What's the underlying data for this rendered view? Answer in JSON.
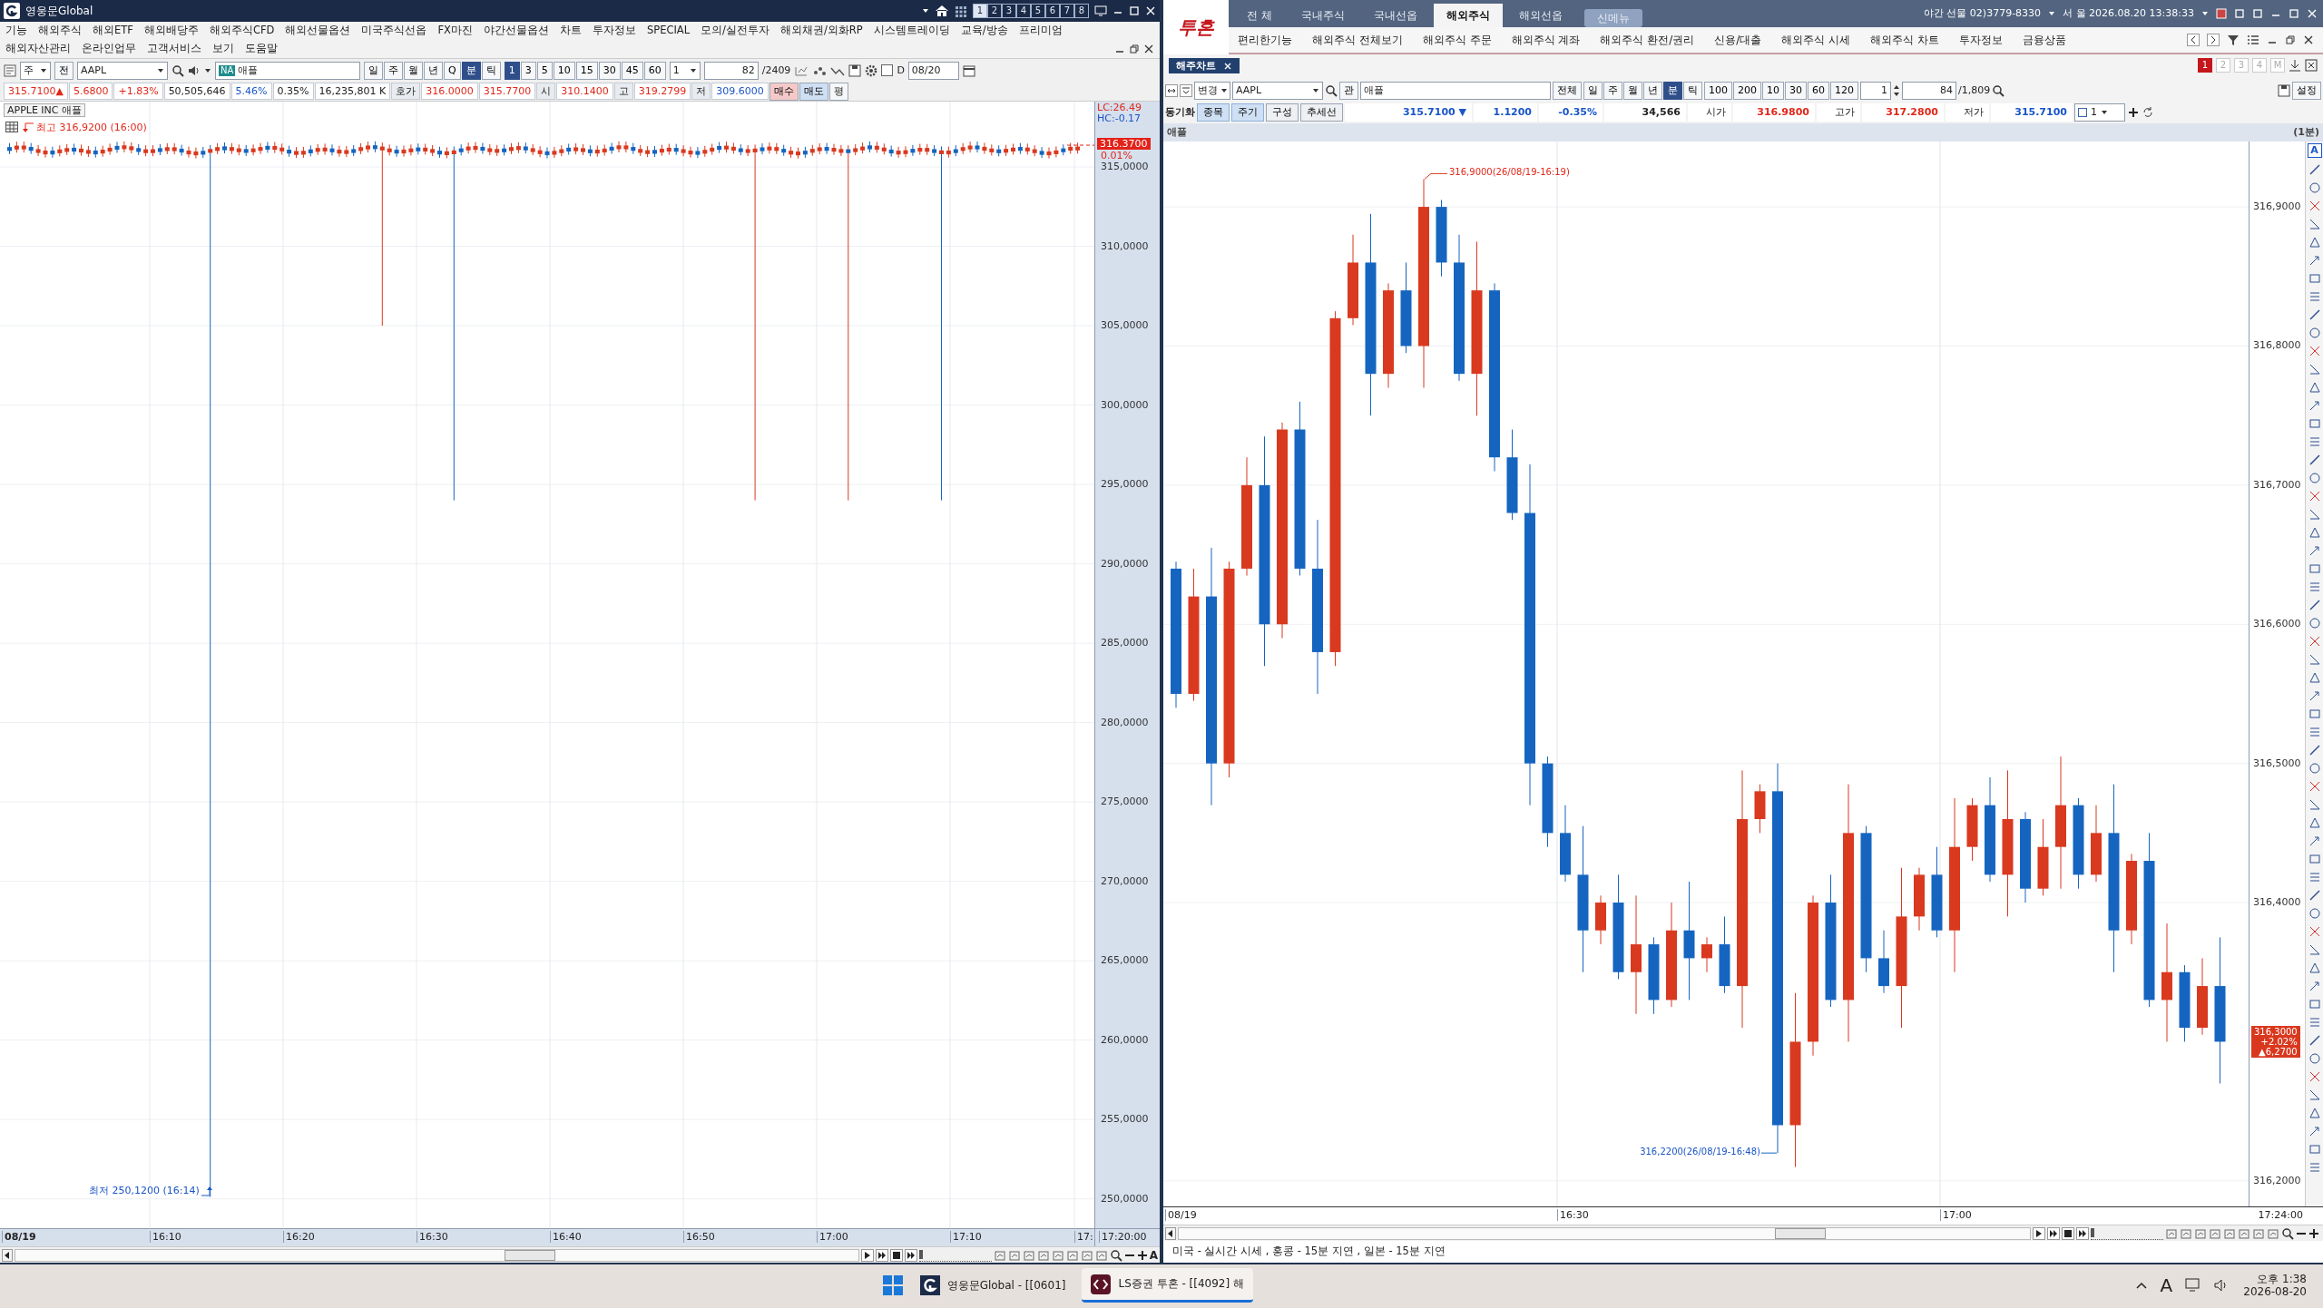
{
  "left_window": {
    "title": "영웅문Global",
    "pages": [
      {
        "label": "1",
        "selected": true
      },
      {
        "label": "2",
        "selected": false
      },
      {
        "label": "3",
        "selected": false
      },
      {
        "label": "4",
        "selected": false
      },
      {
        "label": "5",
        "selected": false
      },
      {
        "label": "6",
        "selected": false
      },
      {
        "label": "7",
        "selected": false
      },
      {
        "label": "8",
        "selected": false
      }
    ],
    "menu_rows": [
      [
        "기능",
        "해외주식",
        "해외ETF",
        "해외배당주",
        "해외주식CFD",
        "해외선물옵션",
        "미국주식선옵",
        "FX마진",
        "야간선물옵션",
        "차트",
        "투자정보",
        "SPECIAL",
        "모의/실전투자",
        "해외채권/외화RP",
        "시스템트레이딩",
        "교육/방송",
        "프리미엄"
      ],
      [
        "해외자산관리",
        "온라인업무",
        "고객서비스",
        "보기",
        "도움말"
      ]
    ],
    "toolbar": {
      "market": "주",
      "scope": "전",
      "symbol": "AAPL",
      "badge": "NA",
      "name": "애플",
      "periods": [
        {
          "label": "일",
          "selected": false
        },
        {
          "label": "주",
          "selected": false
        },
        {
          "label": "월",
          "selected": false
        },
        {
          "label": "년",
          "selected": false
        },
        {
          "label": "Q",
          "selected": false
        },
        {
          "label": "분",
          "selected": true
        },
        {
          "label": "틱",
          "selected": false
        }
      ],
      "intervals": [
        {
          "label": "1",
          "selected": true
        },
        {
          "label": "3",
          "selected": false
        },
        {
          "label": "5",
          "selected": false
        },
        {
          "label": "10",
          "selected": false
        },
        {
          "label": "15",
          "selected": false
        },
        {
          "label": "30",
          "selected": false
        },
        {
          "label": "45",
          "selected": false
        },
        {
          "label": "60",
          "selected": false
        }
      ],
      "multiplier": "1",
      "count": "82",
      "total": "/2409",
      "date_flag": "D",
      "date_checked": false,
      "date": "08/20"
    },
    "quote": [
      {
        "text": "315.7100▲",
        "kind": "up"
      },
      {
        "text": "5.6800",
        "kind": "up"
      },
      {
        "text": "+1.83%",
        "kind": "up"
      },
      {
        "text": "50,505,646",
        "kind": "plain"
      },
      {
        "text": "5.46%",
        "kind": "down"
      },
      {
        "text": "0.35%",
        "kind": "plain"
      },
      {
        "text": "16,235,801 K",
        "kind": "plain"
      },
      {
        "text": "호가",
        "kind": "label"
      },
      {
        "text": "316.0000",
        "kind": "up"
      },
      {
        "text": "315.7700",
        "kind": "up"
      },
      {
        "text": "시",
        "kind": "label"
      },
      {
        "text": "310.1400",
        "kind": "up"
      },
      {
        "text": "고",
        "kind": "label"
      },
      {
        "text": "319.2799",
        "kind": "up"
      },
      {
        "text": "저",
        "kind": "label"
      },
      {
        "text": "309.6000",
        "kind": "down"
      }
    ],
    "order_buttons": [
      {
        "label": "매수",
        "kind": "buy"
      },
      {
        "label": "매도",
        "kind": "sell"
      },
      {
        "label": "평",
        "kind": "plain"
      }
    ],
    "chart": {
      "legend": "APPLE INC  애플",
      "high_note": "최고 316,9200 (16:00)",
      "low_note": "최저 250,1200 (16:14)",
      "lc": "LC:26.49",
      "hc": "HC:-0.17",
      "price_tag": "316.3700",
      "change_tag": "0.01%",
      "y_labels": [
        "315,0000",
        "310,0000",
        "305,0000",
        "300,0000",
        "295,0000",
        "290,0000",
        "285,0000",
        "280,0000",
        "275,0000",
        "270,0000",
        "265,0000",
        "260,0000",
        "255,0000",
        "250,0000"
      ],
      "x_labels": [
        "08/19",
        "16:10",
        "16:20",
        "16:30",
        "16:40",
        "16:50",
        "17:00",
        "17:10",
        "17:"
      ],
      "x_end": "17:20:00"
    },
    "zoom": {
      "level": 0
    },
    "font_button": "A"
  },
  "right_window": {
    "logo": "투혼",
    "tabs": [
      {
        "label": "전 체",
        "kind": "tab",
        "selected": false
      },
      {
        "label": "국내주식",
        "kind": "tab",
        "selected": false
      },
      {
        "label": "국내선옵",
        "kind": "tab",
        "selected": false
      },
      {
        "label": "해외주식",
        "kind": "tab",
        "selected": true
      },
      {
        "label": "해외선옵",
        "kind": "tab",
        "selected": false
      },
      {
        "label": "신메뉴",
        "kind": "menu",
        "selected": false
      }
    ],
    "hotline": "야간 선물 02)3779-8330",
    "clock": "서 울 2026.08.20 13:38:33",
    "menu": [
      "편리한기능",
      "해외주식 전체보기",
      "해외주식 주문",
      "해외주식 계좌",
      "해외주식 환전/권리",
      "신용/대출",
      "해외주식 시세",
      "해외주식 차트",
      "투자정보",
      "금융상품"
    ],
    "doc_tab": "해주차트",
    "screens": [
      {
        "label": "1",
        "selected": true
      },
      {
        "label": "2",
        "selected": false
      },
      {
        "label": "3",
        "selected": false
      },
      {
        "label": "4",
        "selected": false
      },
      {
        "label": "M",
        "selected": false
      }
    ],
    "toolbar": {
      "mode": "변경",
      "symbol": "AAPL",
      "watch": "관",
      "name": "애플",
      "all": "전체",
      "periods": [
        {
          "label": "일",
          "selected": false
        },
        {
          "label": "주",
          "selected": false
        },
        {
          "label": "월",
          "selected": false
        },
        {
          "label": "년",
          "selected": false
        },
        {
          "label": "분",
          "selected": true
        },
        {
          "label": "틱",
          "selected": false
        }
      ],
      "intervals": [
        "100",
        "200",
        "10",
        "30",
        "60",
        "120"
      ],
      "multiplier": "1",
      "count": "84",
      "total": "/1,809",
      "settings": "설정"
    },
    "sync": "동기화",
    "view_buttons": [
      {
        "label": "종목",
        "selected": true
      },
      {
        "label": "주기",
        "selected": true
      },
      {
        "label": "구성",
        "selected": false
      },
      {
        "label": "추세선",
        "selected": false
      }
    ],
    "quote": [
      {
        "text": "315.7100 ▼",
        "kind": "down"
      },
      {
        "text": "1.1200",
        "kind": "down"
      },
      {
        "text": "-0.35%",
        "kind": "down"
      },
      {
        "text": "34,566",
        "kind": "plain"
      },
      {
        "text": "시가",
        "kind": "label"
      },
      {
        "text": "316.9800",
        "kind": "up"
      },
      {
        "text": "고가",
        "kind": "label"
      },
      {
        "text": "317.2800",
        "kind": "up"
      },
      {
        "text": "저가",
        "kind": "label"
      },
      {
        "text": "315.7100",
        "kind": "down"
      }
    ],
    "chart_count": "1",
    "chart": {
      "title": "애플",
      "period": "(1분)",
      "high_note": "316,9000(26/08/19-16:19)",
      "low_note": "316,2200(26/08/19-16:48)",
      "y_labels": [
        "316,9000",
        "316,8000",
        "316,7000",
        "316,6000",
        "316,5000",
        "316,4000",
        "316,2000"
      ],
      "x_labels": [
        "08/19",
        "16:30",
        "17:00"
      ],
      "x_end": "17:24:00",
      "tag": [
        "316,3000",
        "+2.02%",
        "▲6,2700"
      ]
    },
    "font_button": "A",
    "zoom": {
      "level": 0
    },
    "status": "미국 - 실시간 시세 , 홍콩 - 15분 지연 , 일본 - 15분 지연"
  },
  "taskbar": {
    "apps": [
      {
        "label": "영웅문Global - [[0601]",
        "selected": false
      },
      {
        "label": "LS증권 투혼 - [[4092] 해",
        "selected": true
      }
    ],
    "ime": "A",
    "time": "오후 1:38",
    "date": "2026-08-20"
  }
}
